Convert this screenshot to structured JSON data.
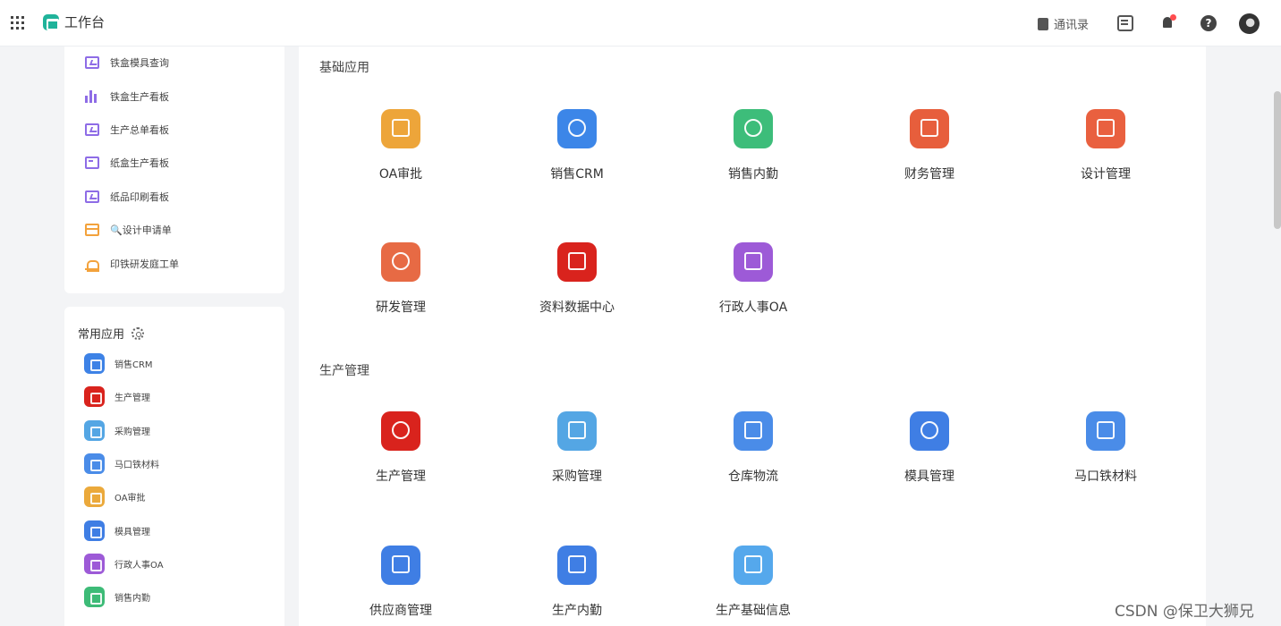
{
  "header": {
    "title": "工作台",
    "contacts_label": "通讯录"
  },
  "sidebar": {
    "report_links": [
      {
        "label": "铁盒模具查询",
        "icon": "screen-chart-icon"
      },
      {
        "label": "铁盒生产看板",
        "icon": "bar-chart-icon"
      },
      {
        "label": "生产总单看板",
        "icon": "screen-chart-icon"
      },
      {
        "label": "纸盒生产看板",
        "icon": "calculator-icon"
      },
      {
        "label": "纸品印刷看板",
        "icon": "screen-chart-icon"
      },
      {
        "label": "🔍设计申请单",
        "icon": "store-icon"
      },
      {
        "label": "印铁研发庭工单",
        "icon": "alarm-icon"
      }
    ],
    "common_apps": {
      "title": "常用应用",
      "items": [
        {
          "label": "销售CRM",
          "color": "#3d82e6"
        },
        {
          "label": "生产管理",
          "color": "#d9231d"
        },
        {
          "label": "采购管理",
          "color": "#54a6e4"
        },
        {
          "label": "马口铁材料",
          "color": "#4a8ce8"
        },
        {
          "label": "OA审批",
          "color": "#eba93b"
        },
        {
          "label": "模具管理",
          "color": "#3f7ee4"
        },
        {
          "label": "行政人事OA",
          "color": "#9d5ad7"
        },
        {
          "label": "销售内勤",
          "color": "#3dbb77"
        }
      ]
    }
  },
  "main": {
    "sections": [
      {
        "title": "基础应用",
        "apps": [
          {
            "label": "OA审批",
            "color": "#eda53a",
            "icon": "oa-icon"
          },
          {
            "label": "销售CRM",
            "color": "#3c86e8",
            "icon": "crm-hub-icon"
          },
          {
            "label": "销售内勤",
            "color": "#3dbd7a",
            "icon": "crm-cloud-icon"
          },
          {
            "label": "财务管理",
            "color": "#e75e3c",
            "icon": "yen-icon"
          },
          {
            "label": "设计管理",
            "color": "#e9603f",
            "icon": "store-icon"
          },
          {
            "label": "研发管理",
            "color": "#e76a44",
            "icon": "planet-icon"
          },
          {
            "label": "资料数据中心",
            "color": "#d9231d",
            "icon": "calligraphy-icon"
          },
          {
            "label": "行政人事OA",
            "color": "#9d5ad7",
            "icon": "oa-icon"
          }
        ]
      },
      {
        "title": "生产管理",
        "apps": [
          {
            "label": "生产管理",
            "color": "#d9231d",
            "icon": "mfg-icon"
          },
          {
            "label": "采购管理",
            "color": "#54a6e4",
            "icon": "hand-package-icon"
          },
          {
            "label": "仓库物流",
            "color": "#4a8ce8",
            "icon": "truck-icon"
          },
          {
            "label": "模具管理",
            "color": "#3f7ee4",
            "icon": "gear-mes-icon"
          },
          {
            "label": "马口铁材料",
            "color": "#4a8ce8",
            "icon": "store-icon"
          },
          {
            "label": "供应商管理",
            "color": "#3f7ee4",
            "icon": "warehouse-icon"
          },
          {
            "label": "生产内勤",
            "color": "#3f7ee4",
            "icon": "warehouse-icon"
          },
          {
            "label": "生产基础信息",
            "color": "#55a8ec",
            "icon": "cart-icon"
          }
        ]
      }
    ]
  },
  "watermark": "CSDN @保卫大狮兄"
}
